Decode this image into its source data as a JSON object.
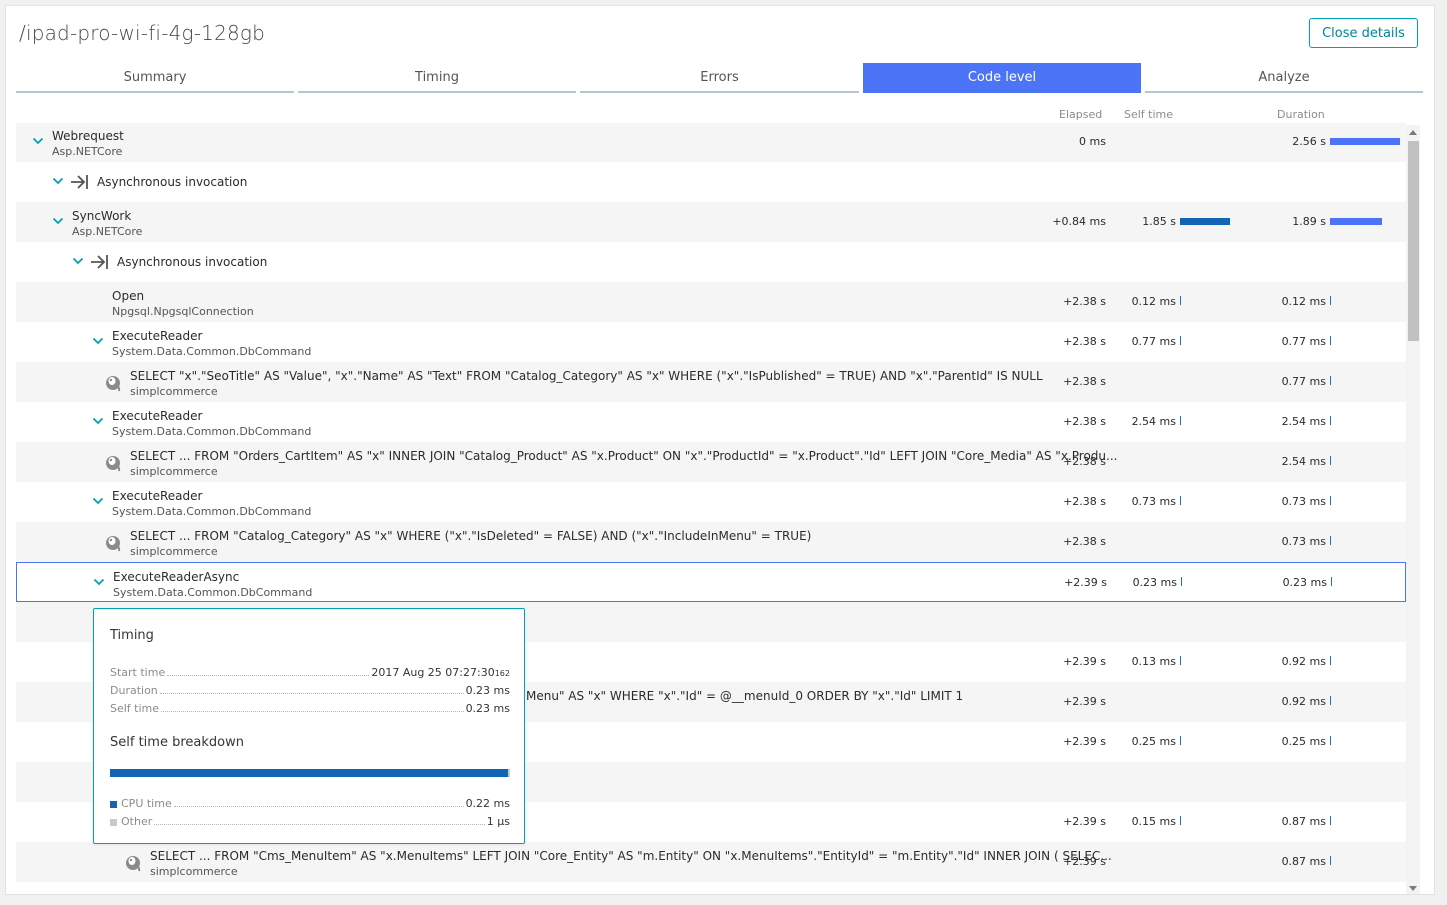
{
  "title": "/ipad-pro-wi-fi-4g-128gb",
  "close_button": "Close details",
  "tabs": [
    {
      "label": "Summary",
      "active": false
    },
    {
      "label": "Timing",
      "active": false
    },
    {
      "label": "Errors",
      "active": false
    },
    {
      "label": "Code level",
      "active": true
    },
    {
      "label": "Analyze",
      "active": false
    }
  ],
  "columns": {
    "elapsed": "Elapsed",
    "self_time": "Self time",
    "duration": "Duration"
  },
  "colors": {
    "accent": "#4b74f7",
    "self_bar": "#1264b5",
    "teal": "#00a1b2"
  },
  "rows": [
    {
      "name": "Webrequest",
      "sub": "Asp.NETCore",
      "icon": "chevron-down-icon",
      "elapsed": "0 ms",
      "self": "",
      "duration": "2.56 s",
      "dur_frac": 1.0
    },
    {
      "name": "Asynchronous invocation",
      "sub": "",
      "icon": "async-invocation-icon",
      "elapsed": "",
      "self": "",
      "duration": ""
    },
    {
      "name": "SyncWork",
      "sub": "Asp.NETCore",
      "icon": "chevron-down-icon",
      "elapsed": "+0.84 ms",
      "self": "1.85 s",
      "self_frac": 1.0,
      "duration": "1.89 s",
      "dur_frac": 0.74
    },
    {
      "name": "Asynchronous invocation",
      "sub": "",
      "icon": "async-invocation-icon",
      "elapsed": "",
      "self": "",
      "duration": ""
    },
    {
      "name": "Open",
      "sub": "Npgsql.NpgsqlConnection",
      "icon": "",
      "elapsed": "+2.38 s",
      "self": "0.12 ms",
      "duration": "0.12 ms"
    },
    {
      "name": "ExecuteReader",
      "sub": "System.Data.Common.DbCommand",
      "icon": "chevron-down-icon",
      "elapsed": "+2.38 s",
      "self": "0.77 ms",
      "duration": "0.77 ms"
    },
    {
      "name": "SELECT \"x\".\"SeoTitle\" AS \"Value\", \"x\".\"Name\" AS \"Text\" FROM \"Catalog_Category\" AS \"x\" WHERE (\"x\".\"IsPublished\" = TRUE) AND \"x\".\"ParentId\" IS NULL",
      "sub": "simplcommerce",
      "icon": "postgresql-icon",
      "elapsed": "+2.38 s",
      "self": "",
      "duration": "0.77 ms"
    },
    {
      "name": "ExecuteReader",
      "sub": "System.Data.Common.DbCommand",
      "icon": "chevron-down-icon",
      "elapsed": "+2.38 s",
      "self": "2.54 ms",
      "duration": "2.54 ms"
    },
    {
      "name": "SELECT ... FROM \"Orders_CartItem\" AS \"x\" INNER JOIN \"Catalog_Product\" AS \"x.Product\" ON \"x\".\"ProductId\" = \"x.Product\".\"Id\" LEFT JOIN \"Core_Media\" AS \"x.Produ...",
      "sub": "simplcommerce",
      "icon": "postgresql-icon",
      "elapsed": "+2.38 s",
      "self": "",
      "duration": "2.54 ms"
    },
    {
      "name": "ExecuteReader",
      "sub": "System.Data.Common.DbCommand",
      "icon": "chevron-down-icon",
      "elapsed": "+2.38 s",
      "self": "0.73 ms",
      "duration": "0.73 ms"
    },
    {
      "name": "SELECT ... FROM \"Catalog_Category\" AS \"x\" WHERE (\"x\".\"IsDeleted\" = FALSE) AND (\"x\".\"IncludeInMenu\" = TRUE)",
      "sub": "simplcommerce",
      "icon": "postgresql-icon",
      "elapsed": "+2.38 s",
      "self": "",
      "duration": "0.73 ms"
    },
    {
      "name": "ExecuteReaderAsync",
      "sub": "System.Data.Common.DbCommand",
      "icon": "chevron-down-icon",
      "elapsed": "+2.39 s",
      "self": "0.23 ms",
      "duration": "0.23 ms",
      "selected": true
    },
    {
      "name": "",
      "sub": "",
      "icon": "chevron-down-icon",
      "elapsed": "",
      "self": "",
      "duration": ""
    },
    {
      "name": "",
      "sub": "",
      "icon": "",
      "elapsed": "+2.39 s",
      "self": "0.13 ms",
      "duration": "0.92 ms"
    },
    {
      "name": "Menu\" AS \"x\" WHERE \"x\".\"Id\" = @__menuId_0 ORDER BY \"x\".\"Id\" LIMIT 1",
      "sub": "",
      "icon": "",
      "elapsed": "+2.39 s",
      "self": "",
      "duration": "0.92 ms"
    },
    {
      "name": "",
      "sub": "",
      "icon": "chevron-down-icon",
      "elapsed": "+2.39 s",
      "self": "0.25 ms",
      "duration": "0.25 ms"
    },
    {
      "name": "",
      "sub": "",
      "icon": "chevron-down-icon",
      "elapsed": "",
      "self": "",
      "duration": ""
    },
    {
      "name": "",
      "sub": "",
      "icon": "",
      "elapsed": "+2.39 s",
      "self": "0.15 ms",
      "duration": "0.87 ms"
    },
    {
      "name": "SELECT ... FROM \"Cms_MenuItem\" AS \"x.MenuItems\" LEFT JOIN \"Core_Entity\" AS \"m.Entity\" ON \"x.MenuItems\".\"EntityId\" = \"m.Entity\".\"Id\" INNER JOIN ( SELEC...",
      "sub": "simplcommerce",
      "icon": "postgresql-icon",
      "elapsed": "+2.39 s",
      "self": "",
      "duration": "0.87 ms"
    }
  ],
  "tooltip": {
    "title": "Timing",
    "start_label": "Start time",
    "start_value": "2017 Aug 25 07:27:30",
    "start_ms": "162",
    "duration_label": "Duration",
    "duration_value": "0.23 ms",
    "self_label": "Self time",
    "self_value": "0.23 ms",
    "breakdown_title": "Self time breakdown",
    "cpu_label": "CPU time",
    "cpu_value": "0.22 ms",
    "other_label": "Other",
    "other_value": "1 µs",
    "cpu_color": "#1264b5",
    "other_color": "#c9c9c9"
  }
}
